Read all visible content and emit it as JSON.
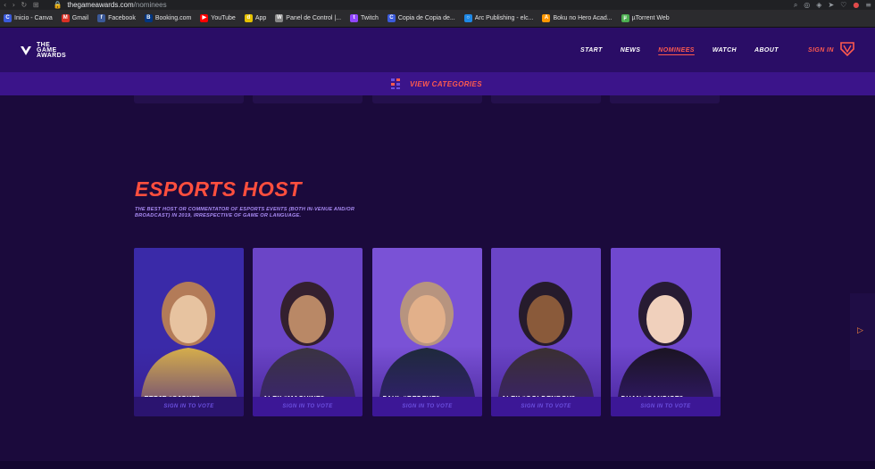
{
  "browser": {
    "url_domain": "thegameawards.com",
    "url_path": "/nominees",
    "bookmarks": [
      {
        "label": "Inicio - Canva",
        "icon": "canva-icon",
        "color": "#3b5bdb",
        "glyph": "C"
      },
      {
        "label": "Gmail",
        "icon": "gmail-icon",
        "color": "#d93025",
        "glyph": "M"
      },
      {
        "label": "Facebook",
        "icon": "facebook-icon",
        "color": "#3b5998",
        "glyph": "f"
      },
      {
        "label": "Booking.com",
        "icon": "booking-icon",
        "color": "#003580",
        "glyph": "B"
      },
      {
        "label": "YouTube",
        "icon": "youtube-icon",
        "color": "#ff0000",
        "glyph": "▶"
      },
      {
        "label": "App",
        "icon": "app-icon",
        "color": "#e5c100",
        "glyph": "d"
      },
      {
        "label": "Panel de Control |...",
        "icon": "panel-icon",
        "color": "#888888",
        "glyph": "W"
      },
      {
        "label": "Twitch",
        "icon": "twitch-icon",
        "color": "#9146ff",
        "glyph": "t"
      },
      {
        "label": "Copia de Copia de...",
        "icon": "canva-icon",
        "color": "#3b5bdb",
        "glyph": "C"
      },
      {
        "label": "Arc Publishing - elc...",
        "icon": "arc-icon",
        "color": "#1e88e5",
        "glyph": "○"
      },
      {
        "label": "Boku no Hero Acad...",
        "icon": "anime-icon",
        "color": "#ff9800",
        "glyph": "A"
      },
      {
        "label": "µTorrent Web",
        "icon": "utorrent-icon",
        "color": "#4caf50",
        "glyph": "µ"
      }
    ]
  },
  "header": {
    "logo_line1": "THE",
    "logo_line2": "GAME",
    "logo_line3": "AWARDS",
    "nav": [
      "START",
      "NEWS",
      "NOMINEES",
      "WATCH",
      "ABOUT"
    ],
    "active_nav": "NOMINEES",
    "sign_in": "SIGN IN",
    "view_categories": "VIEW CATEGORIES"
  },
  "section": {
    "title": "ESPORTS HOST",
    "description": "THE BEST HOST OR COMMENTATOR OF ESPORTS EVENTS (BOTH IN-VENUE AND/OR BROADCAST) IN 2019, IRRESPECTIVE OF GAME OR LANGUAGE."
  },
  "nominees": [
    {
      "line1": "EEFJE “SJOKZ”",
      "line2": "DEPOORTERE",
      "vote": "SIGN IN TO VOTE"
    },
    {
      "line1": "ALEX “MACHINE”",
      "line2": "RICHARDSON",
      "vote": "SIGN IN TO VOTE"
    },
    {
      "line1": "PAUL “REDEYE”",
      "line2": "CHALONER",
      "vote": "SIGN IN TO VOTE"
    },
    {
      "line1": "ALEX “GOLDENBOY”",
      "line2": "MENDEZ",
      "vote": "SIGN IN TO VOTE"
    },
    {
      "line1": "DUAN “CANDICE”",
      "line2": "YU-SHUANG",
      "vote": "SIGN IN TO VOTE"
    }
  ],
  "colors": {
    "accent": "#ff4f3e",
    "header_bg": "#2a0d66",
    "page_bg": "#1b0a3c",
    "card_bg": "#6b45c7",
    "vote_text": "#6b4fe0"
  }
}
